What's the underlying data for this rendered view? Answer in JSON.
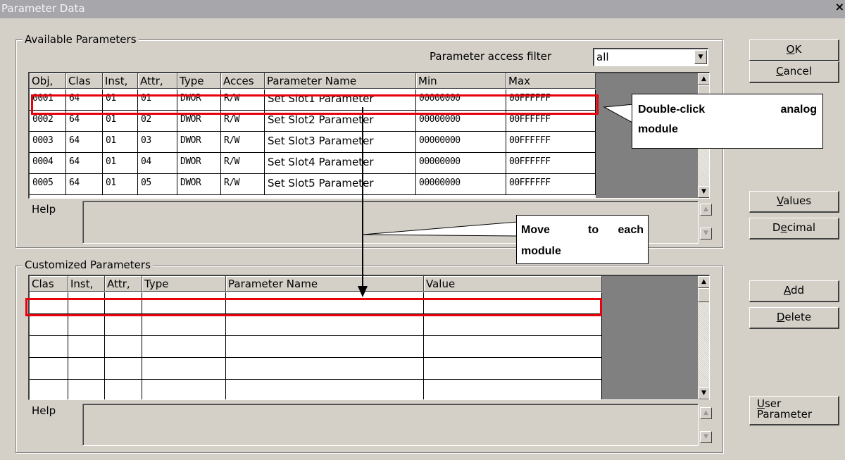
{
  "window": {
    "title": "Parameter Data",
    "close_glyph": "×"
  },
  "available": {
    "group_label": "Available Parameters",
    "filter_label": "Parameter access filter",
    "filter_value": "all",
    "columns": [
      "Obj,",
      "Clas",
      "Inst,",
      "Attr,",
      "Type",
      "Acces",
      "Parameter Name",
      "Min",
      "Max"
    ],
    "rows": [
      [
        "0001",
        "64",
        "01",
        "01",
        "DWOR",
        "R/W",
        "Set Slot1 Parameter",
        "00000000",
        "00FFFFFF"
      ],
      [
        "0002",
        "64",
        "01",
        "02",
        "DWOR",
        "R/W",
        "Set Slot2 Parameter",
        "00000000",
        "00FFFFFF"
      ],
      [
        "0003",
        "64",
        "01",
        "03",
        "DWOR",
        "R/W",
        "Set Slot3 Parameter",
        "00000000",
        "00FFFFFF"
      ],
      [
        "0004",
        "64",
        "01",
        "04",
        "DWOR",
        "R/W",
        "Set Slot4 Parameter",
        "00000000",
        "00FFFFFF"
      ],
      [
        "0005",
        "64",
        "01",
        "05",
        "DWOR",
        "R/W",
        "Set Slot5 Parameter",
        "00000000",
        "00FFFFFF"
      ]
    ],
    "help_label": "Help"
  },
  "customized": {
    "group_label": "Customized Parameters",
    "columns": [
      "Clas",
      "Inst,",
      "Attr,",
      "Type",
      "Parameter Name",
      "Value"
    ],
    "help_label": "Help"
  },
  "buttons": {
    "ok": {
      "mn": "O",
      "rest": "K"
    },
    "cancel": {
      "mn": "C",
      "rest": "ancel"
    },
    "values": {
      "mn": "V",
      "rest": "alues"
    },
    "decimal": {
      "pre": "D",
      "mn": "e",
      "rest": "cimal"
    },
    "add": {
      "mn": "A",
      "rest": "dd"
    },
    "delete": {
      "mn": "D",
      "rest": "elete"
    },
    "user_parameter": {
      "mn": "U",
      "line1_rest": "ser",
      "line2": "Parameter"
    }
  },
  "annotations": {
    "callout_double_click": {
      "word1": "Double-click",
      "word2": "analog",
      "line2": "module"
    },
    "callout_move": {
      "word1": "Move",
      "word2": "to",
      "word3": "each",
      "line2": "module"
    },
    "highlight_color": "#e8000b"
  },
  "icons": {
    "scroll_up": "▲",
    "scroll_down": "▼",
    "combo_down": "▼"
  }
}
